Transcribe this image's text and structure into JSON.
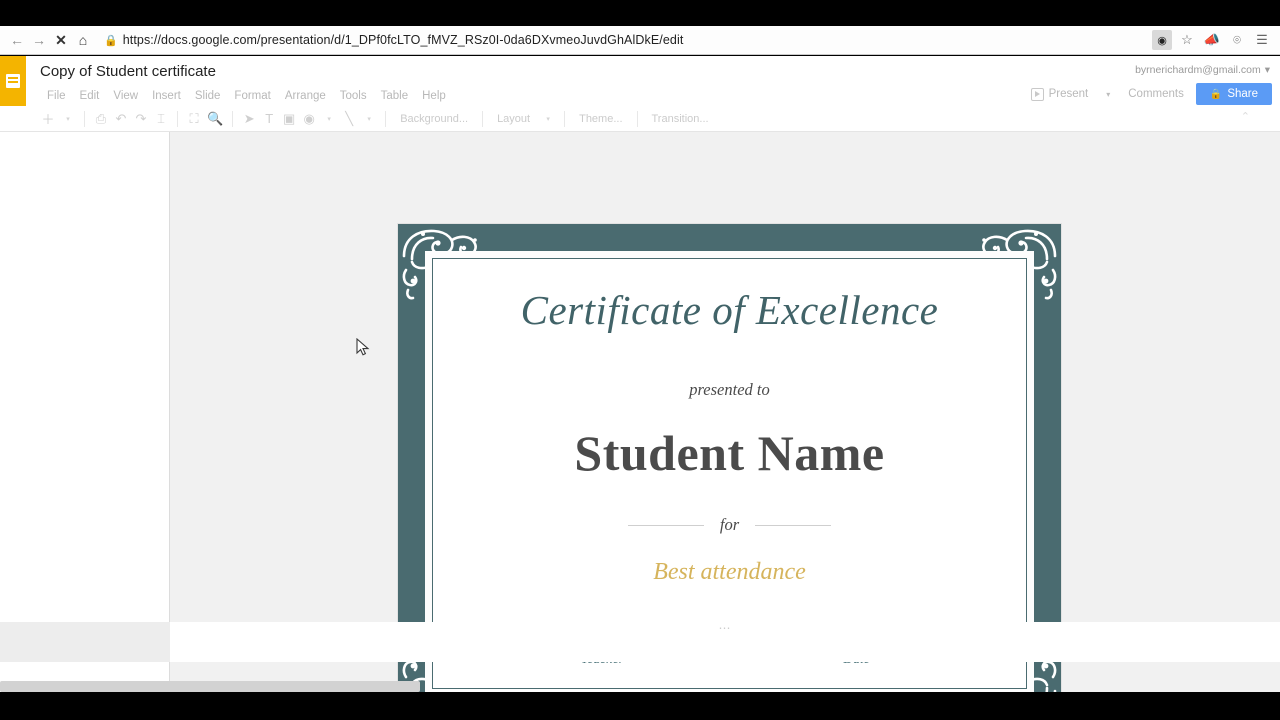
{
  "browser": {
    "nav": {
      "back": "←",
      "forward": "→",
      "stop": "✕",
      "home": "⌂"
    },
    "url_secure_label": "https://",
    "url_domain": "docs.google.com",
    "url_path": "/presentation/d/1_DPf0fcLTO_fMVZ_RSz0I-0da6DXvmeoJuvdGhAlDkE/edit",
    "url_full": "https://docs.google.com/presentation/d/1_DPf0fcLTO_fMVZ_RSz0I-0da6DXvmeoJuvdGhAlDkE/edit",
    "icons": {
      "lock": "lock-icon",
      "extension": "extension-icon",
      "bookmark_star": "star-icon",
      "announcement": "megaphone-icon",
      "small_ext": "puzzle-icon",
      "menu": "hamburger-menu-icon"
    }
  },
  "app": {
    "logo_name": "google-slides-logo",
    "doc_title": "Copy of Student certificate",
    "menu_items": [
      "File",
      "Edit",
      "View",
      "Insert",
      "Slide",
      "Format",
      "Arrange",
      "Tools",
      "Table",
      "Help"
    ],
    "account_email": "byrnerichardm@gmail.com",
    "account_caret": "▾",
    "present_label": "Present",
    "present_caret": "▾",
    "comments_label": "Comments",
    "share_label": "Share",
    "collapse_caret": "⌃"
  },
  "toolbar": {
    "icons": [
      {
        "name": "new-slide-icon",
        "glyph": "＋"
      },
      {
        "name": "new-slide-caret-icon",
        "glyph": "▾"
      },
      {
        "name": "print-icon",
        "glyph": "⎙"
      },
      {
        "name": "undo-icon",
        "glyph": "↶"
      },
      {
        "name": "redo-icon",
        "glyph": "↷"
      },
      {
        "name": "paint-format-icon",
        "glyph": "⌶"
      },
      {
        "name": "fit-to-window-icon",
        "glyph": "⛶"
      },
      {
        "name": "zoom-icon",
        "glyph": "🔍"
      },
      {
        "name": "select-tool-icon",
        "glyph": "➤"
      },
      {
        "name": "text-box-icon",
        "glyph": "T"
      },
      {
        "name": "insert-image-icon",
        "glyph": "▣"
      },
      {
        "name": "shape-icon",
        "glyph": "◉"
      },
      {
        "name": "shape-caret-icon",
        "glyph": "▾"
      },
      {
        "name": "line-icon",
        "glyph": "╲"
      },
      {
        "name": "line-caret-icon",
        "glyph": "▾"
      }
    ],
    "background_label": "Background...",
    "layout_label": "Layout",
    "layout_caret": "▾",
    "theme_label": "Theme...",
    "transition_label": "Transition..."
  },
  "slide": {
    "colors": {
      "border_teal": "#4a6b70",
      "title_teal": "#416368",
      "name_gray": "#4b4b4b",
      "award_gold": "#d6b45c",
      "signature_teal": "#4a7278"
    },
    "title": "Certificate of Excellence",
    "presented_to": "presented to",
    "recipient_name": "Student Name",
    "for_word": "for",
    "award_reason": "Best attendance",
    "signature_left_label": "Teacher",
    "signature_right_label": "Date",
    "ornament_name": "corner-flourish-ornament"
  },
  "notes": {
    "handle": "⋯"
  }
}
